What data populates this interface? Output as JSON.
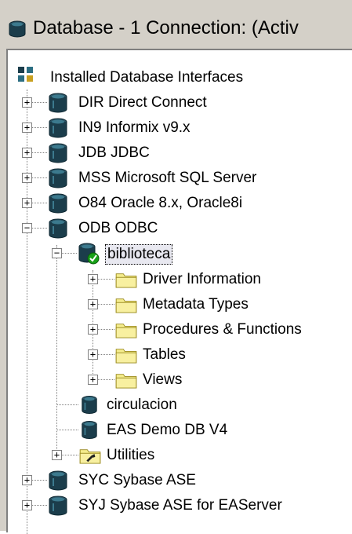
{
  "window": {
    "title": "Database - 1 Connection: (Activ"
  },
  "tree": {
    "root": {
      "label": "Installed Database Interfaces",
      "icon": "database-grid-icon"
    },
    "items": [
      {
        "label": "DIR Direct Connect",
        "expanded": false
      },
      {
        "label": "IN9 Informix v9.x",
        "expanded": false
      },
      {
        "label": "JDB JDBC",
        "expanded": false
      },
      {
        "label": "MSS Microsoft SQL Server",
        "expanded": false
      },
      {
        "label": "O84 Oracle 8.x, Oracle8i",
        "expanded": false
      },
      {
        "label": "ODB ODBC",
        "expanded": true,
        "profiles": [
          {
            "label": "biblioteca",
            "connected": true,
            "selected": true,
            "folders": [
              "Driver Information",
              "Metadata Types",
              "Procedures & Functions",
              "Tables",
              "Views"
            ]
          },
          {
            "label": "circulacion",
            "connected": false
          },
          {
            "label": "EAS Demo DB V4",
            "connected": false
          }
        ],
        "utilities": {
          "label": "Utilities"
        }
      },
      {
        "label": "SYC Sybase ASE",
        "expanded": false
      },
      {
        "label": "SYJ Sybase ASE for EAServer",
        "expanded": false
      }
    ]
  },
  "colors": {
    "db_icon": "#1b3d4b",
    "folder": "#f4ec8c",
    "folder_edge": "#9a8a20",
    "connected_check": "#18a018",
    "panel_bg": "#ffffff",
    "chrome": "#d4d0c8"
  }
}
